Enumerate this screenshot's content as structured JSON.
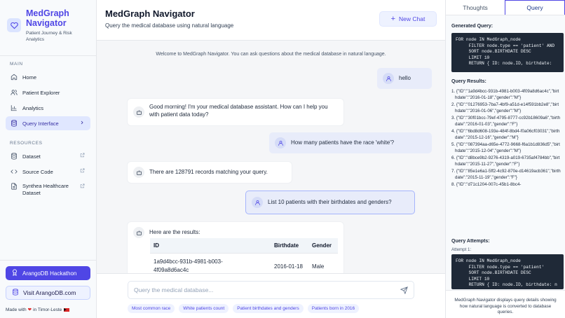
{
  "brand": {
    "title": "MedGraph Navigator",
    "subtitle": "Patient Journey & Risk Analytics"
  },
  "sidebar": {
    "main_heading": "MAIN",
    "main_items": [
      {
        "label": "Home",
        "icon": "home-icon"
      },
      {
        "label": "Patient Explorer",
        "icon": "users-icon"
      },
      {
        "label": "Analytics",
        "icon": "bar-chart-icon"
      },
      {
        "label": "Query Interface",
        "icon": "database-icon",
        "active": true
      }
    ],
    "resources_heading": "RESOURCES",
    "resource_items": [
      {
        "label": "Dataset",
        "icon": "database-icon"
      },
      {
        "label": "Source Code",
        "icon": "code-icon"
      },
      {
        "label": "Synthea Healthcare Dataset",
        "icon": "file-icon"
      }
    ],
    "hackathon_label": "ArangoDB Hackathon",
    "visit_label": "Visit ArangoDB.com",
    "made_with_prefix": "Made with",
    "made_with_suffix": "in Timor-Leste"
  },
  "header": {
    "title": "MedGraph Navigator",
    "subtitle": "Query the medical database using natural language",
    "new_chat_label": "New Chat"
  },
  "chat": {
    "welcome": "Welcome to MedGraph Navigator. You can ask questions about the medical database in natural language.",
    "messages": [
      {
        "role": "user",
        "text": "hello"
      },
      {
        "role": "bot",
        "text": "Good morning! I'm your medical database assistant. How can I help you with patient data today?"
      },
      {
        "role": "user",
        "text": "How many patients have the race 'white'?"
      },
      {
        "role": "bot",
        "text": "There are 128791 records matching your query."
      },
      {
        "role": "user",
        "text": "List 10 patients with their birthdates and genders?"
      },
      {
        "role": "bot",
        "text": "Here are the results:"
      }
    ],
    "table": {
      "headers": [
        "ID",
        "Birthdate",
        "Gender"
      ],
      "rows": [
        [
          "1a9d4bcc-931b-4981-b003-4f09a8d6ac4c",
          "2016-01-18",
          "Male"
        ]
      ]
    },
    "input_placeholder": "Query the medical database...",
    "suggestions": [
      "Most common race",
      "White patients count",
      "Patient birthdates and genders",
      "Patients born in 2016"
    ]
  },
  "panel": {
    "tabs": [
      "Thoughts",
      "Query"
    ],
    "active_tab": "Query",
    "generated_label": "Generated Query:",
    "generated_code": "FOR node IN MedGraph_node\n     FILTER node.type == 'patient' AND\n     SORT node.BIRTHDATE DESC\n     LIMIT 10\n     RETURN { ID: node.ID, birthdate:",
    "results_label": "Query Results:",
    "results": [
      "1. {\"ID\":\"1a9d4bcc-931b-4981-b003-4f09a8d6ac4c\",\"birthdate\":\"2016-01-18\",\"gender\":\"M\"}",
      "2. {\"ID\":\"01276953-7ba7-4bf9-a51d-e14f591bb2e8\",\"birthdate\":\"2016-01-06\",\"gender\":\"M\"}",
      "3. {\"ID\":\"30f01bcc-79ef-4795-8777-cc92b18609a6\",\"birthdate\":\"2016-01-03\",\"gender\":\"F\"}",
      "4. {\"ID\":\"6bd8d608-193e-484f-8bd4-f0a06cf03031\",\"birthdate\":\"2015-12-16\",\"gender\":\"M\"}",
      "5. {\"ID\":\"087394aa-d65e-4772-9668-f6a1b1d836d5\",\"birthdate\":\"2015-12-04\",\"gender\":\"M\"}",
      "6. {\"ID\":\"d8bce9b2-9276-4319-a019-6735af4784bb\",\"birthdate\":\"2015-11-27\",\"gender\":\"F\"}",
      "7. {\"ID\":\"85e1e6a1-5ff2-4c92-870e-d14619acb361\",\"birthdate\":\"2015-11-19\",\"gender\":\"F\"}",
      "8. {\"ID\":\"d71c1204-007c-45b1-8bc4-"
    ],
    "attempts_label": "Query Attempts:",
    "attempt_label": "Attempt 1:",
    "attempt_code": "FOR node IN MedGraph_node\n     FILTER node.type == 'patient'\n     SORT node.BIRTHDATE DESC\n     LIMIT 10\n     RETURN { ID: node.ID, birthdate: n",
    "footer": "MedGraph Navigator displays query details showing how natural language is converted to database queries."
  },
  "colors": {
    "accent": "#4f46e5",
    "accent_light": "#eef2ff",
    "code_bg": "#1f2937"
  }
}
